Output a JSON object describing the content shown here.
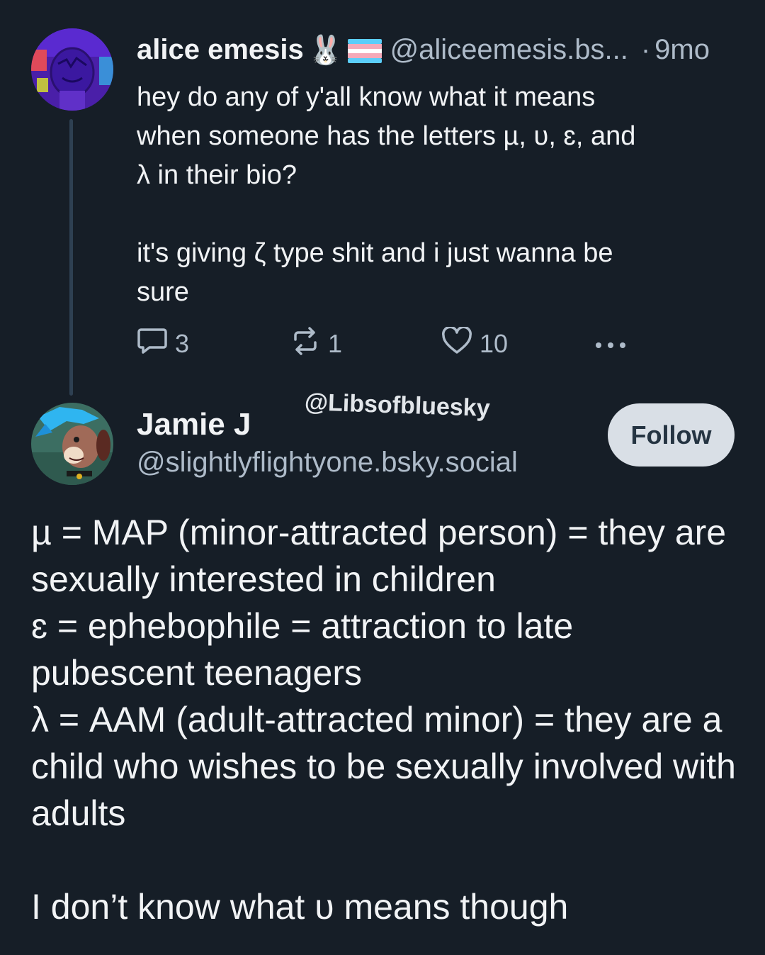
{
  "post1": {
    "display_name": "alice emesis",
    "emoji_1": "🐰",
    "emoji_2": "🏳️‍⚧️",
    "handle": "@aliceemesis.bs...",
    "separator": "·",
    "time": "9mo",
    "text": "hey do any of y'all know what it means\nwhen someone has the letters µ, ᴜ, ɛ, and\nλ in their bio?\n\nit's giving ζ type shit and i just wanna be\nsure",
    "actions": {
      "replies": "3",
      "reposts": "1",
      "likes": "10"
    }
  },
  "watermark": "@Libsofbluesky",
  "post2": {
    "display_name": "Jamie J",
    "handle": "@slightlyflightyone.bsky.social",
    "follow_label": "Follow",
    "lines": [
      "µ = MAP (minor-attracted person) = they are sexually interested in children",
      "ɛ = ephebophile = attraction to late pubescent teenagers",
      "λ = AAM (adult-attracted minor) = they are a child who wishes to be sexually involved with adults",
      "I don’t know what ᴜ means though"
    ]
  },
  "colors": {
    "background": "#161e27",
    "text": "#f1f3f5",
    "muted": "#aebbc9",
    "follow_bg": "#d9dfe6",
    "thread_line": "#2e4052"
  },
  "icons": [
    "reply-icon",
    "repost-icon",
    "like-icon",
    "more-icon"
  ]
}
